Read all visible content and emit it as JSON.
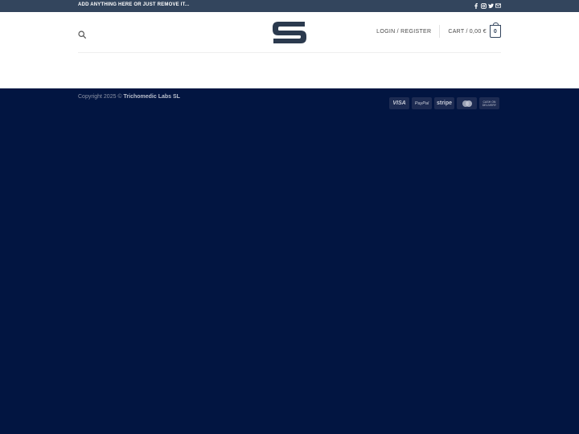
{
  "topbar": {
    "text": "ADD ANYTHING HERE OR JUST REMOVE IT..."
  },
  "social": [
    "facebook-icon",
    "instagram-icon",
    "twitter-icon",
    "email-icon"
  ],
  "header": {
    "login": "LOGIN / REGISTER",
    "cart_label": "CART",
    "cart_sep": "/",
    "cart_amount": "0,00 €",
    "cart_count": "0"
  },
  "footer": {
    "copyright_prefix": "Copyright 2025 ©",
    "copyright_owner": "Trichomedic Labs SL",
    "payments": {
      "visa": "VISA",
      "paypal": "PayPal",
      "stripe": "stripe",
      "cod_line1": "CASH ON",
      "cod_line2": "DELIVERY"
    }
  },
  "colors": {
    "topbar_bg": "#33455d",
    "footer_bg": "#021541",
    "logo": "#2b3a4e"
  }
}
